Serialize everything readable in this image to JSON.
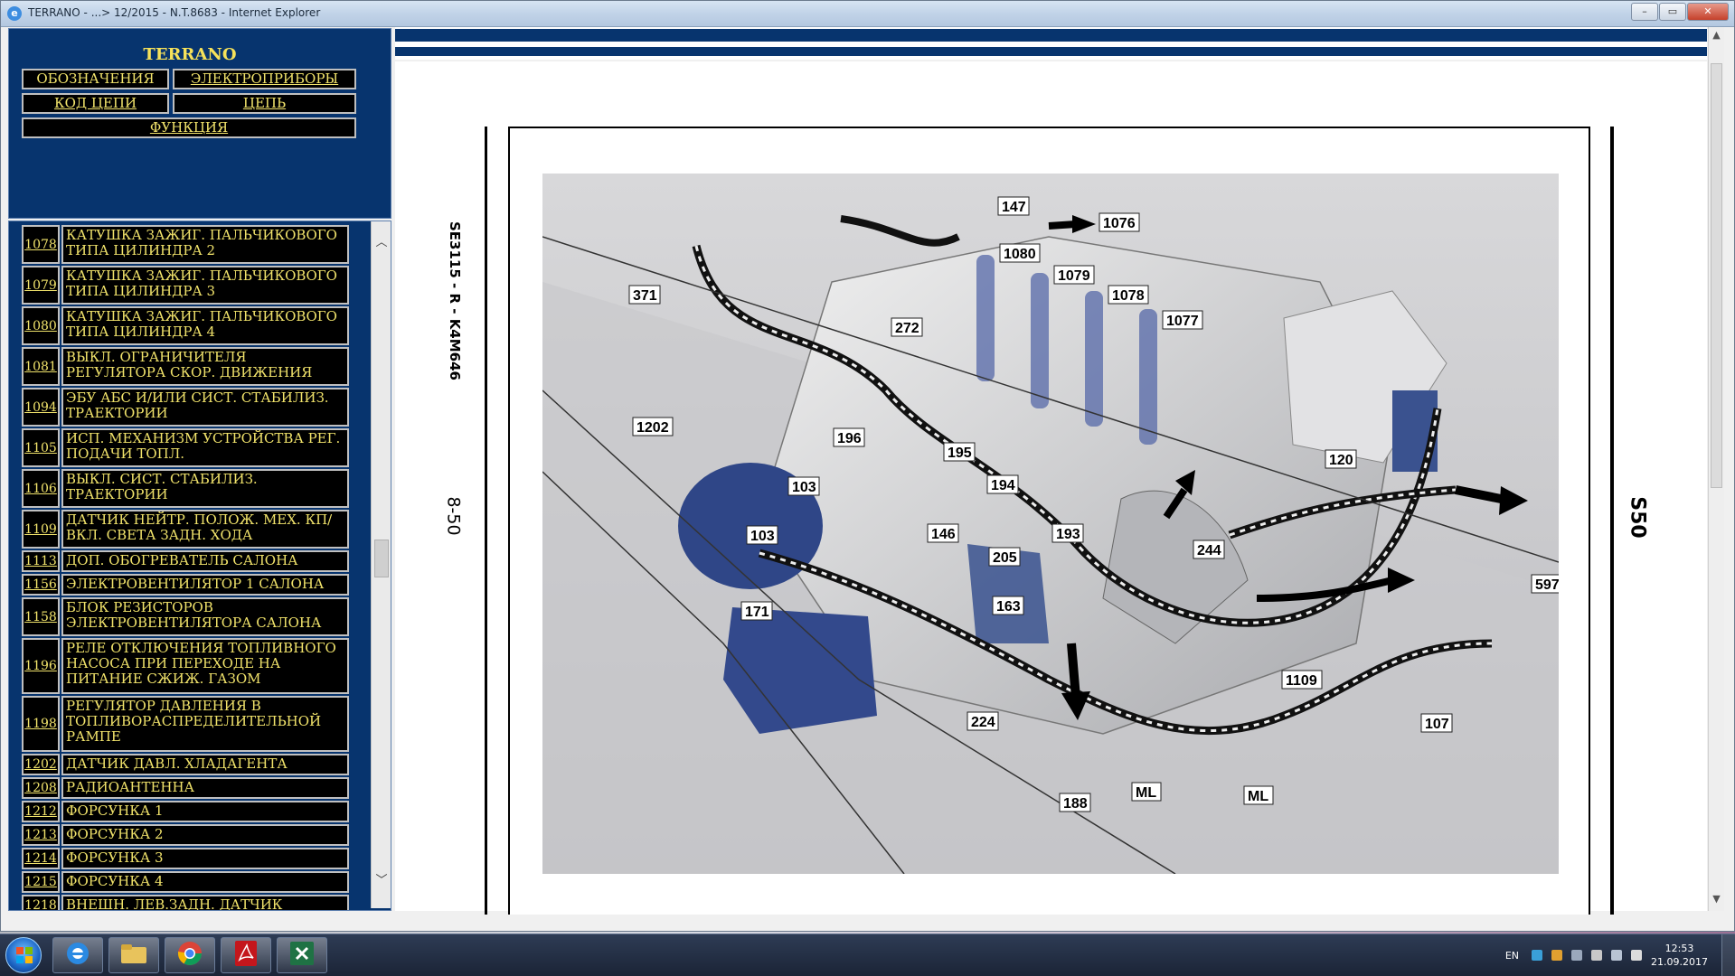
{
  "window": {
    "title": "TERRANO - ...> 12/2015 - N.T.8683 - Internet Explorer",
    "ie_letter": "e",
    "minimize": "–",
    "maximize": "▭",
    "close": "✕"
  },
  "nav": {
    "brand": "TERRANO",
    "buttons": {
      "designations": "ОБОЗНАЧЕНИЯ",
      "devices": "ЭЛЕКТРОПРИБОРЫ",
      "circuit_code": "КОД ЦЕПИ",
      "circuit": "ЦЕПЬ",
      "function": "ФУНКЦИЯ"
    }
  },
  "list": [
    {
      "code": "1078",
      "label": "КАТУШКА ЗАЖИГ. ПАЛЬЧИКОВОГО ТИПА ЦИЛИНДРА 2"
    },
    {
      "code": "1079",
      "label": "КАТУШКА ЗАЖИГ. ПАЛЬЧИКОВОГО ТИПА ЦИЛИНДРА 3"
    },
    {
      "code": "1080",
      "label": "КАТУШКА ЗАЖИГ. ПАЛЬЧИКОВОГО ТИПА ЦИЛИНДРА 4"
    },
    {
      "code": "1081",
      "label": "ВЫКЛ. ОГРАНИЧИТЕЛЯ РЕГУЛЯТОРА СКОР. ДВИЖЕНИЯ"
    },
    {
      "code": "1094",
      "label": "ЭБУ АБС И/ИЛИ СИСТ. СТАБИЛИЗ. ТРАЕКТОРИИ"
    },
    {
      "code": "1105",
      "label": "ИСП. МЕХАНИЗМ УСТРОЙСТВА РЕГ. ПОДАЧИ ТОПЛ."
    },
    {
      "code": "1106",
      "label": "ВЫКЛ. СИСТ. СТАБИЛИЗ. ТРАЕКТОРИИ"
    },
    {
      "code": "1109",
      "label": "ДАТЧИК НЕЙТР. ПОЛОЖ. МЕХ. КП/ВКЛ. СВЕТА ЗАДН. ХОДА"
    },
    {
      "code": "1113",
      "label": "ДОП. ОБОГРЕВАТЕЛЬ САЛОНА"
    },
    {
      "code": "1156",
      "label": "ЭЛЕКТРОВЕНТИЛЯТОР 1 САЛОНА"
    },
    {
      "code": "1158",
      "label": "БЛОК РЕЗИСТОРОВ ЭЛЕКТРОВЕНТИЛЯТОРА САЛОНА"
    },
    {
      "code": "1196",
      "label": "РЕЛЕ ОТКЛЮЧЕНИЯ ТОПЛИВНОГО НАСОСА ПРИ ПЕРЕХОДЕ НА ПИТАНИЕ СЖИЖ. ГАЗОМ"
    },
    {
      "code": "1198",
      "label": "РЕГУЛЯТОР ДАВЛЕНИЯ В ТОПЛИВОРАСПРЕДЕЛИТЕЛЬНОЙ РАМПЕ"
    },
    {
      "code": "1202",
      "label": "ДАТЧИК ДАВЛ. ХЛАДАГЕНТА"
    },
    {
      "code": "1208",
      "label": "РАДИОАНТЕННА"
    },
    {
      "code": "1212",
      "label": "ФОРСУНКА 1"
    },
    {
      "code": "1213",
      "label": "ФОРСУНКА 2"
    },
    {
      "code": "1214",
      "label": "ФОРСУНКА 3"
    },
    {
      "code": "1215",
      "label": "ФОРСУНКА 4"
    },
    {
      "code": "1218",
      "label": "ВНЕШН. ЛЕВ.ЗАДН. ДАТЧИК"
    }
  ],
  "scroll": {
    "up": "︿",
    "down": "﹀",
    "page_up": "▲",
    "page_down": "▼"
  },
  "document": {
    "side_code": "SE3115 - R - K4M646",
    "page_number": "8-50",
    "section": "S50",
    "callouts": [
      "147",
      "1076",
      "1080",
      "1079",
      "1078",
      "1077",
      "371",
      "272",
      "1202",
      "196",
      "195",
      "194",
      "120",
      "103",
      "103",
      "146",
      "193",
      "205",
      "244",
      "597",
      "171",
      "163",
      "1109",
      "224",
      "107",
      "188",
      "ML",
      "ML"
    ]
  },
  "taskbar": {
    "lang": "EN",
    "time": "12:53",
    "date": "21.09.2017"
  }
}
